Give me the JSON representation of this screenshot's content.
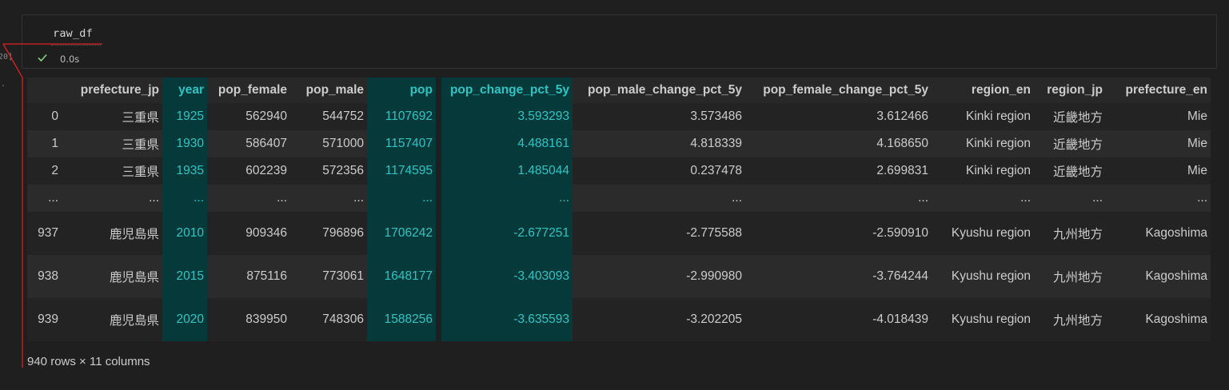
{
  "cell": {
    "code": "raw_df",
    "exec_time": "0.0s",
    "gutter_number": "20]",
    "gutter_dot": "."
  },
  "table": {
    "columns": [
      "",
      "prefecture_jp",
      "year",
      "pop_female",
      "pop_male",
      "pop",
      "pop_change_pct_5y",
      "pop_male_change_pct_5y",
      "pop_female_change_pct_5y",
      "region_en",
      "region_jp",
      "prefecture_en"
    ],
    "rows": [
      [
        "0",
        "三重県",
        "1925",
        "562940",
        "544752",
        "1107692",
        "3.593293",
        "3.573486",
        "3.612466",
        "Kinki region",
        "近畿地方",
        "Mie"
      ],
      [
        "1",
        "三重県",
        "1930",
        "586407",
        "571000",
        "1157407",
        "4.488161",
        "4.818339",
        "4.168650",
        "Kinki region",
        "近畿地方",
        "Mie"
      ],
      [
        "2",
        "三重県",
        "1935",
        "602239",
        "572356",
        "1174595",
        "1.485044",
        "0.237478",
        "2.699831",
        "Kinki region",
        "近畿地方",
        "Mie"
      ],
      [
        "...",
        "...",
        "...",
        "...",
        "...",
        "...",
        "...",
        "...",
        "...",
        "...",
        "...",
        "..."
      ],
      [
        "937",
        "鹿児島県",
        "2010",
        "909346",
        "796896",
        "1706242",
        "-2.677251",
        "-2.775588",
        "-2.590910",
        "Kyushu region",
        "九州地方",
        "Kagoshima"
      ],
      [
        "938",
        "鹿児島県",
        "2015",
        "875116",
        "773061",
        "1648177",
        "-3.403093",
        "-2.990980",
        "-3.764244",
        "Kyushu region",
        "九州地方",
        "Kagoshima"
      ],
      [
        "939",
        "鹿児島県",
        "2020",
        "839950",
        "748306",
        "1588256",
        "-3.635593",
        "-3.202205",
        "-4.018439",
        "Kyushu region",
        "九州地方",
        "Kagoshima"
      ]
    ],
    "footer": "940 rows × 11 columns"
  },
  "colors": {
    "background": "#1f1f1f",
    "highlight_bg": "#063a3a",
    "highlight_text": "#2ec4c4",
    "annotation_red": "#e02020",
    "check_green": "#89d185"
  },
  "icons": {
    "status": "check-icon"
  }
}
